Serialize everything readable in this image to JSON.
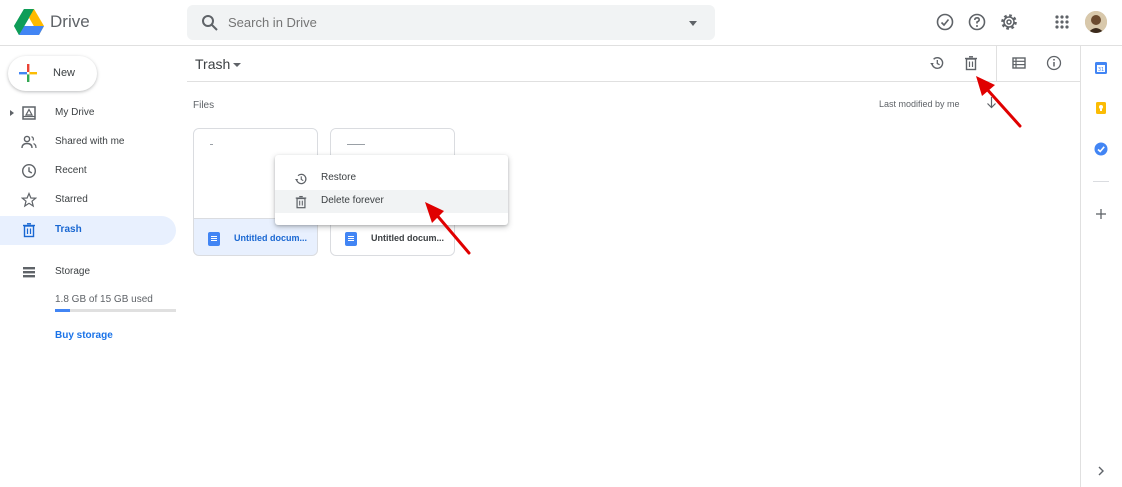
{
  "app": {
    "name": "Drive"
  },
  "search": {
    "placeholder": "Search in Drive"
  },
  "sidebar": {
    "new_label": "New",
    "items": [
      {
        "label": "My Drive"
      },
      {
        "label": "Shared with me"
      },
      {
        "label": "Recent"
      },
      {
        "label": "Starred"
      },
      {
        "label": "Trash"
      }
    ],
    "storage": {
      "label": "Storage",
      "usage": "1.8 GB of 15 GB used",
      "used_fraction": 0.12,
      "buy_label": "Buy storage"
    }
  },
  "main": {
    "title": "Trash",
    "files_label": "Files",
    "sort_label": "Last modified by me",
    "files": [
      {
        "name": "Untitled docum..."
      },
      {
        "name": "Untitled docum..."
      }
    ]
  },
  "context_menu": {
    "items": [
      {
        "label": "Restore"
      },
      {
        "label": "Delete forever"
      }
    ]
  },
  "colors": {
    "accent": "#1a73e8",
    "active_bg": "#e8f0fe",
    "annotation_arrow": "#e00000"
  },
  "icons": [
    "drive-logo-icon",
    "search-icon",
    "offline-icon",
    "help-icon",
    "settings-icon",
    "apps-icon",
    "restore-icon",
    "delete-icon",
    "list-view-icon",
    "info-icon",
    "calendar-icon",
    "keep-icon",
    "tasks-icon",
    "add-icon",
    "chevron-right-icon"
  ]
}
